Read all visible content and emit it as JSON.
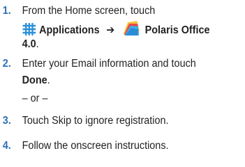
{
  "colors": {
    "number": "#2c6fb7",
    "text": "#222222"
  },
  "steps": [
    {
      "number": "1.",
      "line1": "From the Home screen, touch",
      "apps_icon": "applications-grid-icon",
      "apps_label": "Applications",
      "arrow": "➔",
      "polaris_icon": "polaris-office-icon",
      "polaris_label": "Polaris Office",
      "version": "4.0",
      "period": "."
    },
    {
      "number": "2.",
      "line1": "Enter your Email information and touch",
      "done_label": "Done",
      "period": "."
    },
    {
      "separator": "– or –"
    },
    {
      "number": "3.",
      "text": "Touch Skip to ignore registration."
    },
    {
      "number": "4.",
      "text": "Follow the onscreen instructions."
    }
  ]
}
